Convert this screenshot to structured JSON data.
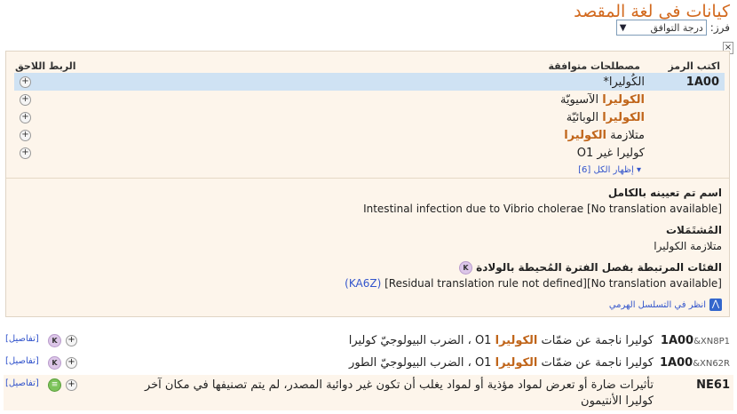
{
  "header": {
    "title": "كيانات في لغة المقصد",
    "sort_label": "فرز:",
    "sort_value": "درجة التوافق",
    "close": "×"
  },
  "panel": {
    "col_code": "اكتب الرمز",
    "col_terms": "مصطلحات متوافقة",
    "col_postcoord": "الربط اللاحق",
    "code": "1A00",
    "terms": [
      {
        "pre": "",
        "hl": "",
        "post": "الكُوليرا*",
        "selected": true
      },
      {
        "pre": "",
        "hl": "الكوليرا",
        "post": " الآسيويّة",
        "selected": false
      },
      {
        "pre": "",
        "hl": "الكوليرا",
        "post": " الوبائيّة",
        "selected": false
      },
      {
        "pre": "متلازمة ",
        "hl": "الكوليرا",
        "post": "",
        "selected": false
      },
      {
        "pre": "",
        "hl": "",
        "post": "كوليرا غير O1",
        "selected": false
      }
    ],
    "show_all": "إظهار الكل [6]",
    "fully_specified_title": "اسم تم تعيينه بالكامل",
    "fully_specified_text": "Intestinal infection due to Vibrio cholerae [No translation available]",
    "inclusions_title": "المُشتَمَلات",
    "inclusions_text": "متلازمة الكوليرا",
    "perinatal_title": "الفئات المرتبطة بفصل الفترة المُحيطة بالولادة",
    "perinatal_badge": "K",
    "perinatal_text": "[Residual translation rule not defined][No translation available]",
    "perinatal_link": "(KA6Z)",
    "hierarchy_link": "انظر في التسلسل الهرمي",
    "hierarchy_icon": "up-arrow-icon"
  },
  "results": [
    {
      "code": "1A00",
      "suffix": "&XN8P1",
      "pre": "كوليرا ناجمة عن ضمّات ",
      "hl": "الكوليرا",
      "post": " O1 ، الضرب البيولوجيّ كوليرا",
      "badge": "K",
      "details": "[تفاصيل]"
    },
    {
      "code": "1A00",
      "suffix": "&XN62R",
      "pre": "كوليرا ناجمة عن ضمّات ",
      "hl": "الكوليرا",
      "post": " O1 ، الضرب البيولوجيّ الطور",
      "badge": "K",
      "details": "[تفاصيل]"
    },
    {
      "code": "NE61",
      "suffix": "",
      "pre": "تأثيرات ضارة أو تعرض لمواد مؤذية أو لمواد يغلب أن تكون غير دوائية المصدر، لم يتم تصنيفها في مكان آخر",
      "hl": "",
      "post": "",
      "line2": "كوليرا الأنتيمون",
      "badge": "≡",
      "details": "[تفاصيل]"
    }
  ],
  "colors": {
    "accent": "#d2691e",
    "highlight": "#c0651a",
    "link": "#3355cc",
    "panel_bg": "#fdf5eb",
    "selected_row": "#cfe2f3"
  }
}
